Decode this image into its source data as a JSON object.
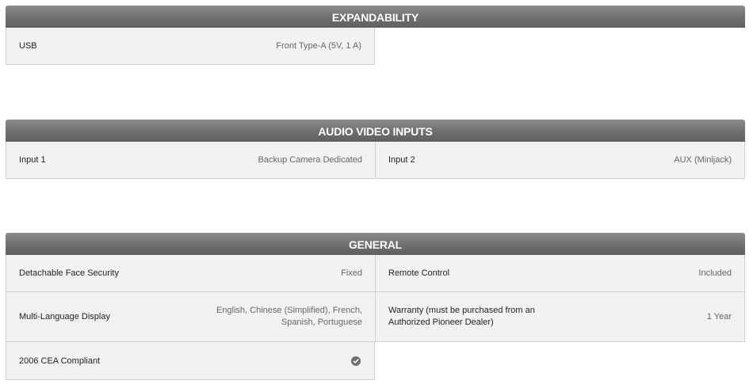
{
  "sections": {
    "expandability": {
      "title": "EXPANDABILITY",
      "rows": [
        {
          "label": "USB",
          "value": "Front Type-A (5V, 1 A)"
        }
      ]
    },
    "audio_video_inputs": {
      "title": "AUDIO VIDEO INPUTS",
      "rows": [
        {
          "label": "Input 1",
          "value": "Backup Camera Dedicated"
        },
        {
          "label": "Input 2",
          "value": "AUX (Minijack)"
        }
      ]
    },
    "general": {
      "title": "GENERAL",
      "rows": [
        {
          "label": "Detachable Face Security",
          "value": "Fixed"
        },
        {
          "label": "Remote Control",
          "value": "Included"
        },
        {
          "label": "Multi-Language Display",
          "value": "English, Chinese (Simplified), French, Spanish, Portuguese"
        },
        {
          "label": "Warranty (must be purchased from an Authorized Pioneer Dealer)",
          "value": "1 Year"
        },
        {
          "label": "2006 CEA Compliant",
          "value_icon": "check-circle-icon"
        }
      ]
    }
  },
  "colors": {
    "header_bg": "#6e6e6e",
    "header_text": "#ffffff",
    "cell_bg": "#f2f2f2",
    "border": "#cfcfcf",
    "value_text": "#666666"
  }
}
